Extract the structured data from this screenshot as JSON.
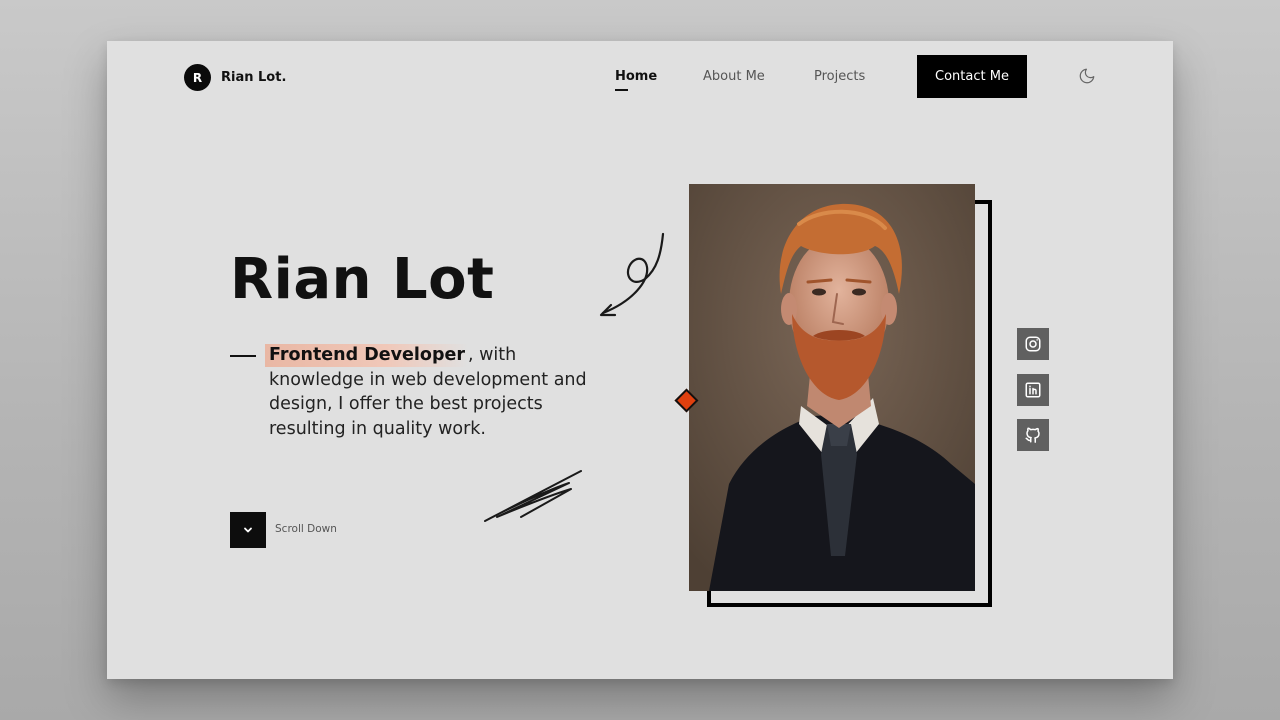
{
  "logo": {
    "initial": "R",
    "name": "Rian Lot."
  },
  "nav": {
    "items": [
      {
        "label": "Home",
        "active": true
      },
      {
        "label": "About Me",
        "active": false
      },
      {
        "label": "Projects",
        "active": false
      }
    ],
    "contact_label": "Contact Me",
    "theme_icon": "moon-icon"
  },
  "hero": {
    "title": "Rian Lot",
    "role": "Frontend Developer",
    "description_line1": ", with knowledge",
    "description_rest": "in web development and design, I offer the best projects resulting in quality work.",
    "scroll_label": "Scroll Down",
    "scroll_icon": "chevron-down-icon"
  },
  "social": [
    "instagram-icon",
    "linkedin-icon",
    "github-icon"
  ],
  "colors": {
    "accent": "#e0400f",
    "highlight": "#e9b7a4",
    "dark": "#000000"
  }
}
